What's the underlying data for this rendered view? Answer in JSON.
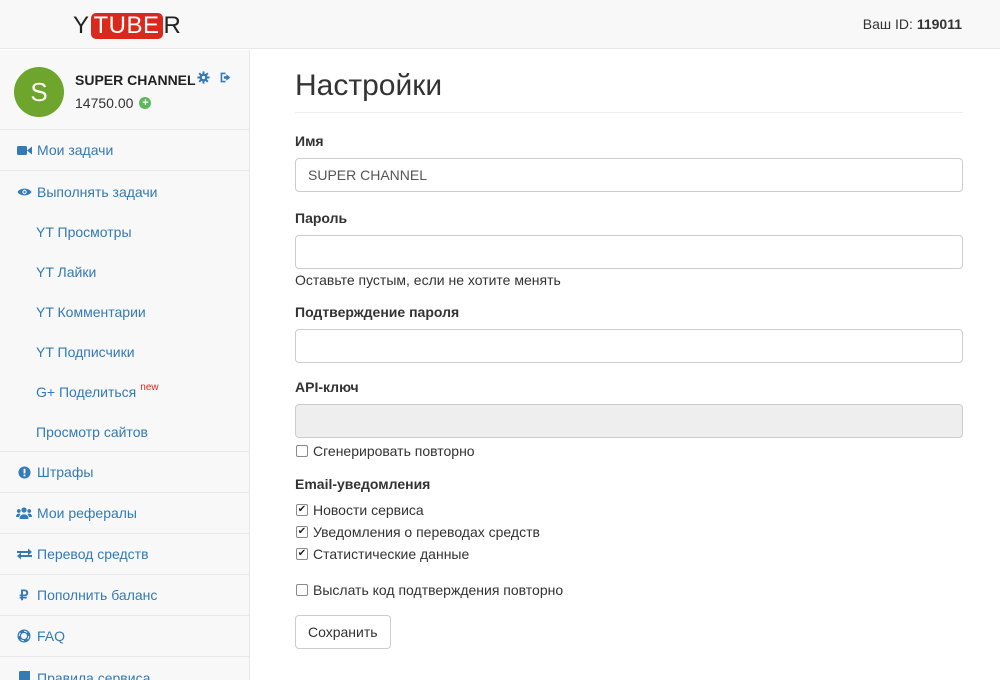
{
  "header": {
    "logo_left": "Y",
    "logo_mid": "TUBE",
    "logo_right": "R",
    "user_id_label": "Ваш ID:",
    "user_id_value": "119011"
  },
  "profile": {
    "avatar_letter": "S",
    "name": "SUPER CHANNEL",
    "balance": "14750.00"
  },
  "sidebar": {
    "my_tasks": "Мои задачи",
    "do_tasks": "Выполнять задачи",
    "sub": [
      "YT Просмотры",
      "YT Лайки",
      "YT Комментарии",
      "YT Подписчики",
      "G+ Поделиться",
      "Просмотр сайтов"
    ],
    "new_badge": "new",
    "items": [
      "Штрафы",
      "Мои рефералы",
      "Перевод средств",
      "Пополнить баланс",
      "FAQ",
      "Правила сервиса"
    ]
  },
  "main": {
    "title": "Настройки",
    "name_label": "Имя",
    "name_value": "SUPER CHANNEL",
    "password_label": "Пароль",
    "password_help": "Оставьте пустым, если не хотите менять",
    "confirm_label": "Подтверждение пароля",
    "api_label": "API-ключ",
    "regenerate_label": "Сгенерировать повторно",
    "email_label": "Email-уведомления",
    "email_options": [
      "Новости сервиса",
      "Уведомления о переводах средств",
      "Статистические данные"
    ],
    "resend_label": "Выслать код подтверждения повторно",
    "save_label": "Сохранить"
  }
}
